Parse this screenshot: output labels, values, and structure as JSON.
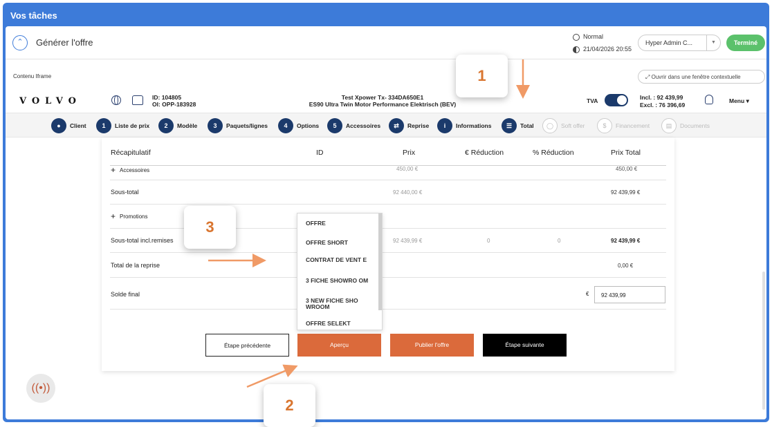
{
  "window": {
    "title": "Vos tâches"
  },
  "generate": {
    "title": "Générer l'offre",
    "status": "Normal",
    "datetime": "21/04/2026 20:55",
    "user": "Hyper Admin C...",
    "done_label": "Terminé"
  },
  "iframe": {
    "label": "Contenu Iframe",
    "open_popup": "Ouvrir dans une fenêtre contextuelle"
  },
  "vehicle": {
    "brand": "VOLVO",
    "id_line": "ID:  104805",
    "oi_line": "OI:  OPP-183928",
    "model_line1": "Test Xpower Tx- 334DA650E1",
    "model_line2": "ES90 Ultra Twin Motor Performance Elektrisch (BEV)",
    "tva_label": "TVA",
    "incl": "Incl. : 92 439,99",
    "excl": "Excl. : 76 396,69",
    "menu_label": "Menu"
  },
  "steps": [
    {
      "num": "",
      "label": "Client",
      "enabled": true
    },
    {
      "num": "1",
      "label": "Liste de prix",
      "enabled": true
    },
    {
      "num": "2",
      "label": "Modèle",
      "enabled": true
    },
    {
      "num": "3",
      "label": "Paquets/lignes",
      "enabled": true
    },
    {
      "num": "4",
      "label": "Options",
      "enabled": true
    },
    {
      "num": "5",
      "label": "Accessoires",
      "enabled": true
    },
    {
      "num": "",
      "label": "Reprise",
      "enabled": true
    },
    {
      "num": "i",
      "label": "Informations",
      "enabled": true
    },
    {
      "num": "",
      "label": "Total",
      "enabled": true
    },
    {
      "num": "",
      "label": "Soft offer",
      "enabled": false
    },
    {
      "num": "$",
      "label": "Financement",
      "enabled": false
    },
    {
      "num": "",
      "label": "Documents",
      "enabled": false
    }
  ],
  "summary": {
    "headers": {
      "recap": "Récapitulatif",
      "id": "ID",
      "price": "Prix",
      "eur_reduction": "€ Réduction",
      "pct_reduction": "% Réduction",
      "total": "Prix Total"
    },
    "accessoires": {
      "label": "Accessoires",
      "price": "450,00 €",
      "total": "450,00 €"
    },
    "sous_total": {
      "label": "Sous-total",
      "price": "92 440,00 €",
      "total": "92 439,99 €"
    },
    "promotions": {
      "label": "Promotions"
    },
    "sous_total_remises": {
      "label": "Sous-total incl.remises",
      "price": "92 439,99 €",
      "eur": "0",
      "pct": "0",
      "total": "92 439,99 €"
    },
    "reprise": {
      "label": "Total de la reprise",
      "total": "0,00 €"
    },
    "solde": {
      "label": "Solde final",
      "currency": "€",
      "value": "92 439,99"
    }
  },
  "buttons": {
    "prev": "Étape précédente",
    "apercu": "Aperçu",
    "publish": "Publier l'offre",
    "next": "Étape suivante"
  },
  "dropdown": {
    "items": [
      "OFFRE",
      "OFFRE SHORT",
      "CONTRAT DE VENT E",
      "3 FICHE SHOWRO OM",
      "3 NEW FICHE SHO WROOM",
      "OFFRE SELEKT"
    ]
  },
  "callouts": [
    "1",
    "2",
    "3"
  ],
  "colors": {
    "header_blue": "#3d7bd9",
    "navy": "#1b3a6b",
    "orange": "#db6a3b",
    "green": "#5bc16b",
    "callout_orange": "#d9752f"
  }
}
